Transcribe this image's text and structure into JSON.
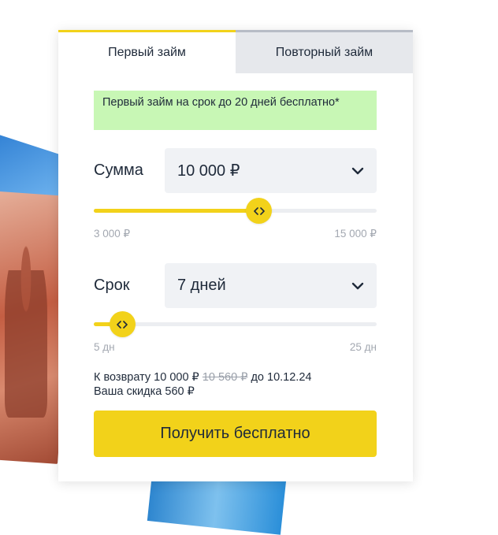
{
  "tabs": [
    {
      "label": "Первый займ",
      "active": true
    },
    {
      "label": "Повторный займ",
      "active": false
    }
  ],
  "promo": "Первый займ на срок до 20 дней бесплатно*",
  "amount": {
    "label": "Сумма",
    "value": "10 000 ₽",
    "min_label": "3 000 ₽",
    "max_label": "15 000 ₽",
    "min": 3000,
    "max": 15000,
    "current": 10000
  },
  "term": {
    "label": "Срок",
    "value": "7 дней",
    "min_label": "5 дн",
    "max_label": "25 дн",
    "min": 5,
    "max": 25,
    "current": 7
  },
  "summary": {
    "return_prefix": "К возврату",
    "return_amount": "10 000 ₽",
    "return_old_amount": "10 560 ₽",
    "date_prefix": "до",
    "date": "10.12.24",
    "discount_prefix": "Ваша скидка",
    "discount_amount": "560 ₽"
  },
  "cta_label": "Получить бесплатно",
  "colors": {
    "accent": "#f2d21a",
    "promo_bg": "#c8f7b5",
    "text": "#1f2a3a"
  },
  "icons": {
    "select_toggle": "chevron-down-icon",
    "slider_handle": "arrows-left-right-icon"
  }
}
